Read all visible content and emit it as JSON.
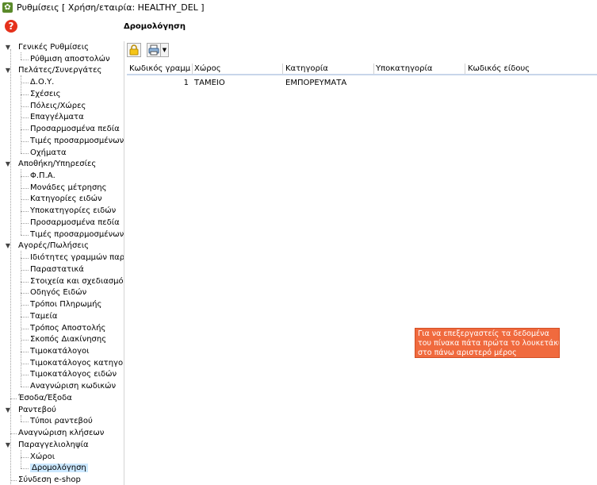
{
  "window": {
    "title": "Ρυθμίσεις  [ Χρήση/εταιρία: HEALTHY_DEL ]"
  },
  "help": {
    "label": "?"
  },
  "section": {
    "title": "Δρομολόγηση"
  },
  "tree": {
    "groups": [
      {
        "label": "Γενικές Ρυθμίσεις",
        "expanded": true,
        "children": [
          "Ρύθμιση αποστολών"
        ]
      },
      {
        "label": "Πελάτες/Συνεργάτες",
        "expanded": true,
        "children": [
          "Δ.Ο.Υ.",
          "Σχέσεις",
          "Πόλεις/Χώρες",
          "Επαγγέλματα",
          "Προσαρμοσμένα πεδία",
          "Τιμές προσαρμοσμένων τ",
          "Οχήματα"
        ]
      },
      {
        "label": "Αποθήκη/Υπηρεσίες",
        "expanded": true,
        "children": [
          "Φ.Π.Α.",
          "Μονάδες μέτρησης",
          "Κατηγορίες ειδών",
          "Υποκατηγορίες ειδών",
          "Προσαρμοσμένα πεδία",
          "Τιμές προσαρμοσμένων τ"
        ]
      },
      {
        "label": "Αγορές/Πωλήσεις",
        "expanded": true,
        "children": [
          "Ιδιότητες γραμμών παραστ",
          "Παραστατικά",
          "Στοιχεία και σχεδιασμός π",
          "Οδηγός Ειδών",
          "Τρόποι Πληρωμής",
          "Ταμεία",
          "Τρόπος Αποστολής",
          "Σκοπός Διακίνησης",
          "Τιμοκατάλογοι",
          "Τιμοκατάλογος κατηγοριώ",
          "Τιμοκατάλογος ειδών",
          "Αναγνώριση κωδικών"
        ]
      },
      {
        "label": "Έσοδα/Έξοδα",
        "expanded": false,
        "children": []
      },
      {
        "label": "Ραντεβού",
        "expanded": true,
        "children": [
          "Τύποι ραντεβού"
        ]
      },
      {
        "label": "Αναγνώριση κλήσεων",
        "expanded": false,
        "children": []
      },
      {
        "label": "Παραγγελιοληψία",
        "expanded": true,
        "children": [
          "Χώροι",
          "Δρομολόγηση"
        ]
      },
      {
        "label": "Σύνδεση e-shop",
        "expanded": false,
        "children": []
      }
    ],
    "selected": "Δρομολόγηση"
  },
  "toolbar": {
    "lock_icon": "lock-icon",
    "print_icon": "printer-icon",
    "dropdown_icon": "chevron-down-icon"
  },
  "grid": {
    "columns": [
      "Κωδικός γραμμής",
      "Χώρος",
      "Κατηγορία",
      "Υποκατηγορία",
      "Κωδικός είδους"
    ],
    "rows": [
      [
        "1",
        "ΤΑΜΕΙΟ",
        "ΕΜΠΟΡΕΥΜΑΤΑ",
        "",
        ""
      ]
    ]
  },
  "tooltip": {
    "lines": [
      "Για να επεξεργαστείς τα δεδομένα",
      "του πίνακα πάτα πρώτα το λουκετάκι",
      "στο πάνω αριστερό μέρος"
    ]
  }
}
